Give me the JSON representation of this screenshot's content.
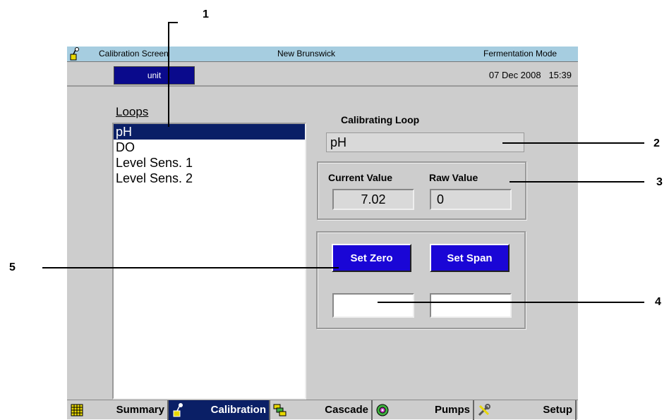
{
  "callouts": [
    "1",
    "2",
    "3",
    "4",
    "5"
  ],
  "titlebar": {
    "screen_title": "Calibration Screen",
    "company": "New Brunswick",
    "mode": "Fermentation Mode"
  },
  "status": {
    "unit_button": "unit",
    "date": "07 Dec 2008",
    "time": "15:39"
  },
  "loops": {
    "label": "Loops",
    "items": [
      "pH",
      "DO",
      "Level Sens. 1",
      "Level Sens. 2"
    ],
    "selected": "pH"
  },
  "calibrating": {
    "label": "Calibrating Loop",
    "value": "pH"
  },
  "values": {
    "current_label": "Current Value",
    "current_value": "7.02",
    "raw_label": "Raw Value",
    "raw_value": "0"
  },
  "buttons": {
    "set_zero": "Set Zero",
    "set_span": "Set Span"
  },
  "navbar": {
    "tabs": [
      "Summary",
      "Calibration",
      "Cascade",
      "Pumps",
      "Setup"
    ],
    "active": "Calibration"
  }
}
